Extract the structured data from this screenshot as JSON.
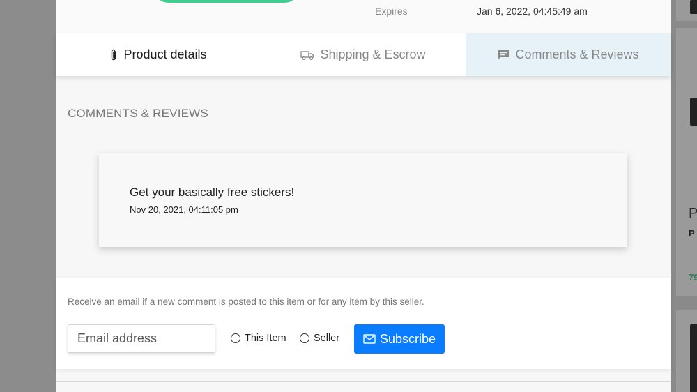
{
  "header": {
    "expires_label": "Expires",
    "expires_value": "Jan 6, 2022, 04:45:49 am"
  },
  "tabs": [
    {
      "label": "Product details",
      "icon": "paperclip-icon",
      "state": "selected-text"
    },
    {
      "label": "Shipping & Escrow",
      "icon": "truck-icon",
      "state": "inactive"
    },
    {
      "label": "Comments & Reviews",
      "icon": "comment-icon",
      "state": "active"
    }
  ],
  "section": {
    "title": "COMMENTS & REVIEWS"
  },
  "comments": [
    {
      "text": "Get your basically free stickers!",
      "date": "Nov 20, 2021, 04:11:05 pm"
    }
  ],
  "subscribe": {
    "info": "Receive an email if a new comment is posted to this item or for any item by this seller.",
    "email_placeholder": "Email address",
    "radio_this_item": "This Item",
    "radio_seller": "Seller",
    "button_label": "Subscribe",
    "button_icon": "envelope-icon"
  },
  "background_listing": {
    "letter": "P",
    "sub_letter": "P",
    "price_fragment": "79"
  },
  "colors": {
    "accent_blue": "#0a7cff",
    "active_tab_bg": "#e6f2f8",
    "green_pill": "#3ecf8e"
  }
}
